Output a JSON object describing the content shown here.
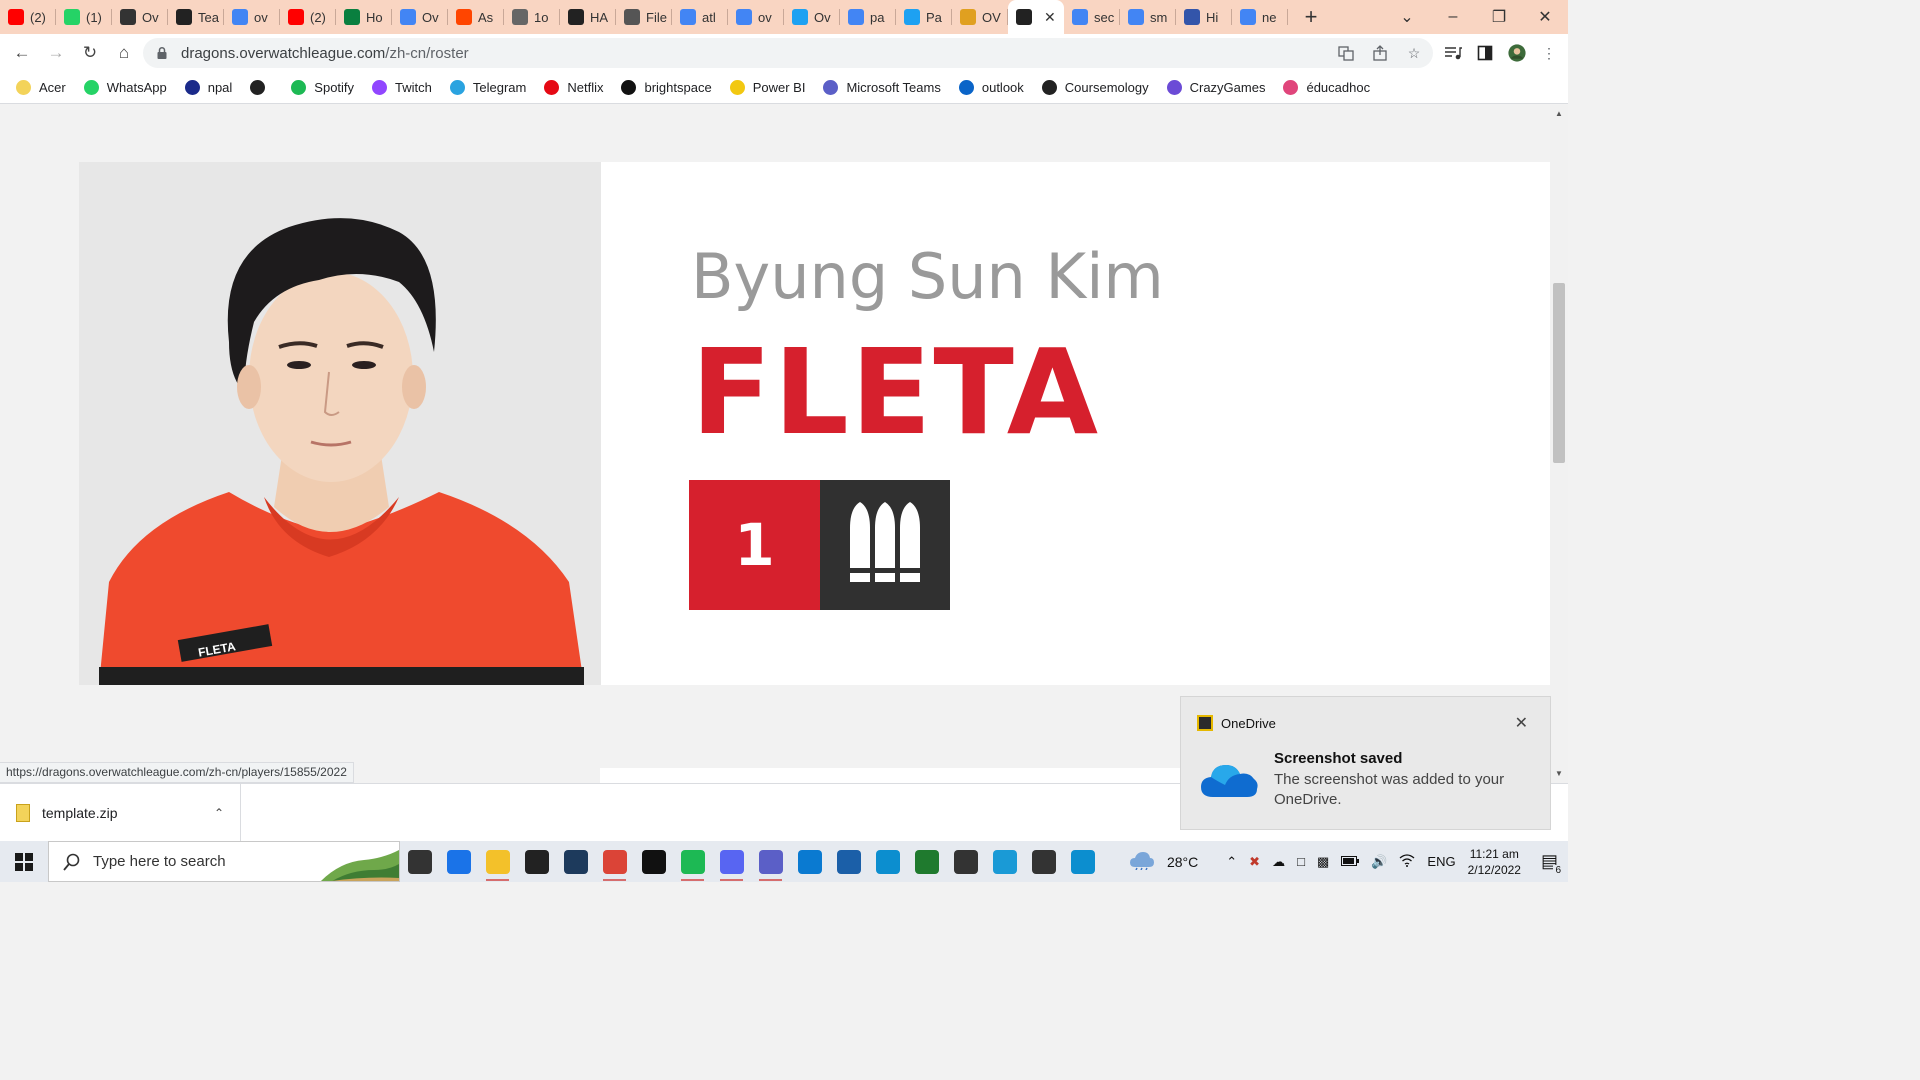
{
  "browser": {
    "tabs": [
      {
        "label": "(2)",
        "icon": "youtube-icon",
        "color": "#ff0000"
      },
      {
        "label": "(1)",
        "icon": "whatsapp-icon",
        "color": "#25d366"
      },
      {
        "label": "Ov",
        "icon": "overwatch-icon",
        "color": "#333333"
      },
      {
        "label": "Tea",
        "icon": "flag-icon",
        "color": "#222222"
      },
      {
        "label": "ov",
        "icon": "google-icon",
        "color": "#4285f4"
      },
      {
        "label": "(2)",
        "icon": "youtube-icon",
        "color": "#ff0000"
      },
      {
        "label": "Ho",
        "icon": "w-icon",
        "color": "#0a7f3f"
      },
      {
        "label": "Ov",
        "icon": "google-icon",
        "color": "#4285f4"
      },
      {
        "label": "As",
        "icon": "reddit-icon",
        "color": "#ff4500"
      },
      {
        "label": "1o",
        "icon": "globe-icon",
        "color": "#666666"
      },
      {
        "label": "HA",
        "icon": "flag-icon",
        "color": "#222222"
      },
      {
        "label": "File",
        "icon": "file-icon",
        "color": "#555555"
      },
      {
        "label": "atl",
        "icon": "google-icon",
        "color": "#4285f4"
      },
      {
        "label": "ov",
        "icon": "google-icon",
        "color": "#4285f4"
      },
      {
        "label": "Ov",
        "icon": "twitter-icon",
        "color": "#1da1f2"
      },
      {
        "label": "pa",
        "icon": "google-icon",
        "color": "#4285f4"
      },
      {
        "label": "Pa",
        "icon": "twitter-icon",
        "color": "#1da1f2"
      },
      {
        "label": "OV",
        "icon": "overwatch-league-icon",
        "color": "#e0a020"
      },
      {
        "label": "",
        "icon": "flag-icon",
        "color": "#222222",
        "active": true
      },
      {
        "label": "sec",
        "icon": "google-icon",
        "color": "#4285f4"
      },
      {
        "label": "sm",
        "icon": "google-icon",
        "color": "#4285f4"
      },
      {
        "label": "Hi",
        "icon": "globe-icon",
        "color": "#3355aa"
      },
      {
        "label": "ne",
        "icon": "google-icon",
        "color": "#4285f4"
      }
    ],
    "url_host": "dragons.overwatchleague.com",
    "url_path": "/zh-cn/roster",
    "bookmarks": [
      {
        "label": "Acer",
        "icon": "folder-icon",
        "color": "#f3d35a"
      },
      {
        "label": "WhatsApp",
        "icon": "whatsapp-icon",
        "color": "#25d366"
      },
      {
        "label": "npal",
        "icon": "npal-icon",
        "color": "#1a2a8a"
      },
      {
        "label": "",
        "icon": "globe-icon",
        "color": "#222222"
      },
      {
        "label": "Spotify",
        "icon": "spotify-icon",
        "color": "#1db954"
      },
      {
        "label": "Twitch",
        "icon": "twitch-icon",
        "color": "#9146ff"
      },
      {
        "label": "Telegram",
        "icon": "telegram-icon",
        "color": "#2aa3e0"
      },
      {
        "label": "Netflix",
        "icon": "netflix-icon",
        "color": "#e50914"
      },
      {
        "label": "brightspace",
        "icon": "np-icon",
        "color": "#111111"
      },
      {
        "label": "Power BI",
        "icon": "powerbi-icon",
        "color": "#f2c811"
      },
      {
        "label": "Microsoft Teams",
        "icon": "teams-icon",
        "color": "#5b5fc7"
      },
      {
        "label": "outlook",
        "icon": "outlook-icon",
        "color": "#0a64c8"
      },
      {
        "label": "Coursemology",
        "icon": "coursemology-icon",
        "color": "#222222"
      },
      {
        "label": "CrazyGames",
        "icon": "crazygames-icon",
        "color": "#6b4bd6"
      },
      {
        "label": "éducadhoc",
        "icon": "educadhoc-icon",
        "color": "#e0457b"
      }
    ],
    "status_url": "https://dragons.overwatchleague.com/zh-cn/players/15855/2022"
  },
  "player": {
    "real_name": "Byung Sun Kim",
    "handle": "FLETA",
    "number": "1",
    "role_icon": "damage-role-icon",
    "jersey_text": "FLETA",
    "accent_color": "#d6202d",
    "role_badge_color": "#303030"
  },
  "downloads": {
    "file_name": "template.zip"
  },
  "toast": {
    "app": "OneDrive",
    "title": "Screenshot saved",
    "body": "The screenshot was added to your OneDrive."
  },
  "taskbar": {
    "search_placeholder": "Type here to search",
    "weather": "28°C",
    "language": "ENG",
    "time": "11:21 am",
    "date": "2/12/2022",
    "notification_count": "6",
    "apps": [
      {
        "icon": "task-view-icon",
        "color": "#333333",
        "running": false
      },
      {
        "icon": "mail-icon",
        "color": "#1a73e8",
        "running": false
      },
      {
        "icon": "file-explorer-icon",
        "color": "#f3c12a",
        "running": true
      },
      {
        "icon": "dropbox-icon",
        "color": "#222222",
        "running": false
      },
      {
        "icon": "store-icon",
        "color": "#1d3a5c",
        "running": false
      },
      {
        "icon": "chrome-icon",
        "color": "#db4437",
        "running": true
      },
      {
        "icon": "netflix-icon",
        "color": "#111111",
        "running": false
      },
      {
        "icon": "spotify-icon",
        "color": "#1db954",
        "running": true
      },
      {
        "icon": "discord-icon",
        "color": "#5865f2",
        "running": true
      },
      {
        "icon": "teams-icon",
        "color": "#5b5fc7",
        "running": true
      },
      {
        "icon": "vscode-icon",
        "color": "#0a7ad1",
        "running": false
      },
      {
        "icon": "photos-icon",
        "color": "#1b5fa8",
        "running": false
      },
      {
        "icon": "edge-icon",
        "color": "#0c8ecf",
        "running": false
      },
      {
        "icon": "pycharm-icon",
        "color": "#1f7a2e",
        "running": false
      },
      {
        "icon": "unity-icon",
        "color": "#333333",
        "running": false
      },
      {
        "icon": "maya-icon",
        "color": "#1a9ad6",
        "running": false
      },
      {
        "icon": "unity-hub-icon",
        "color": "#333333",
        "running": false
      },
      {
        "icon": "edge-beta-icon",
        "color": "#0c8ecf",
        "running": false
      }
    ]
  }
}
